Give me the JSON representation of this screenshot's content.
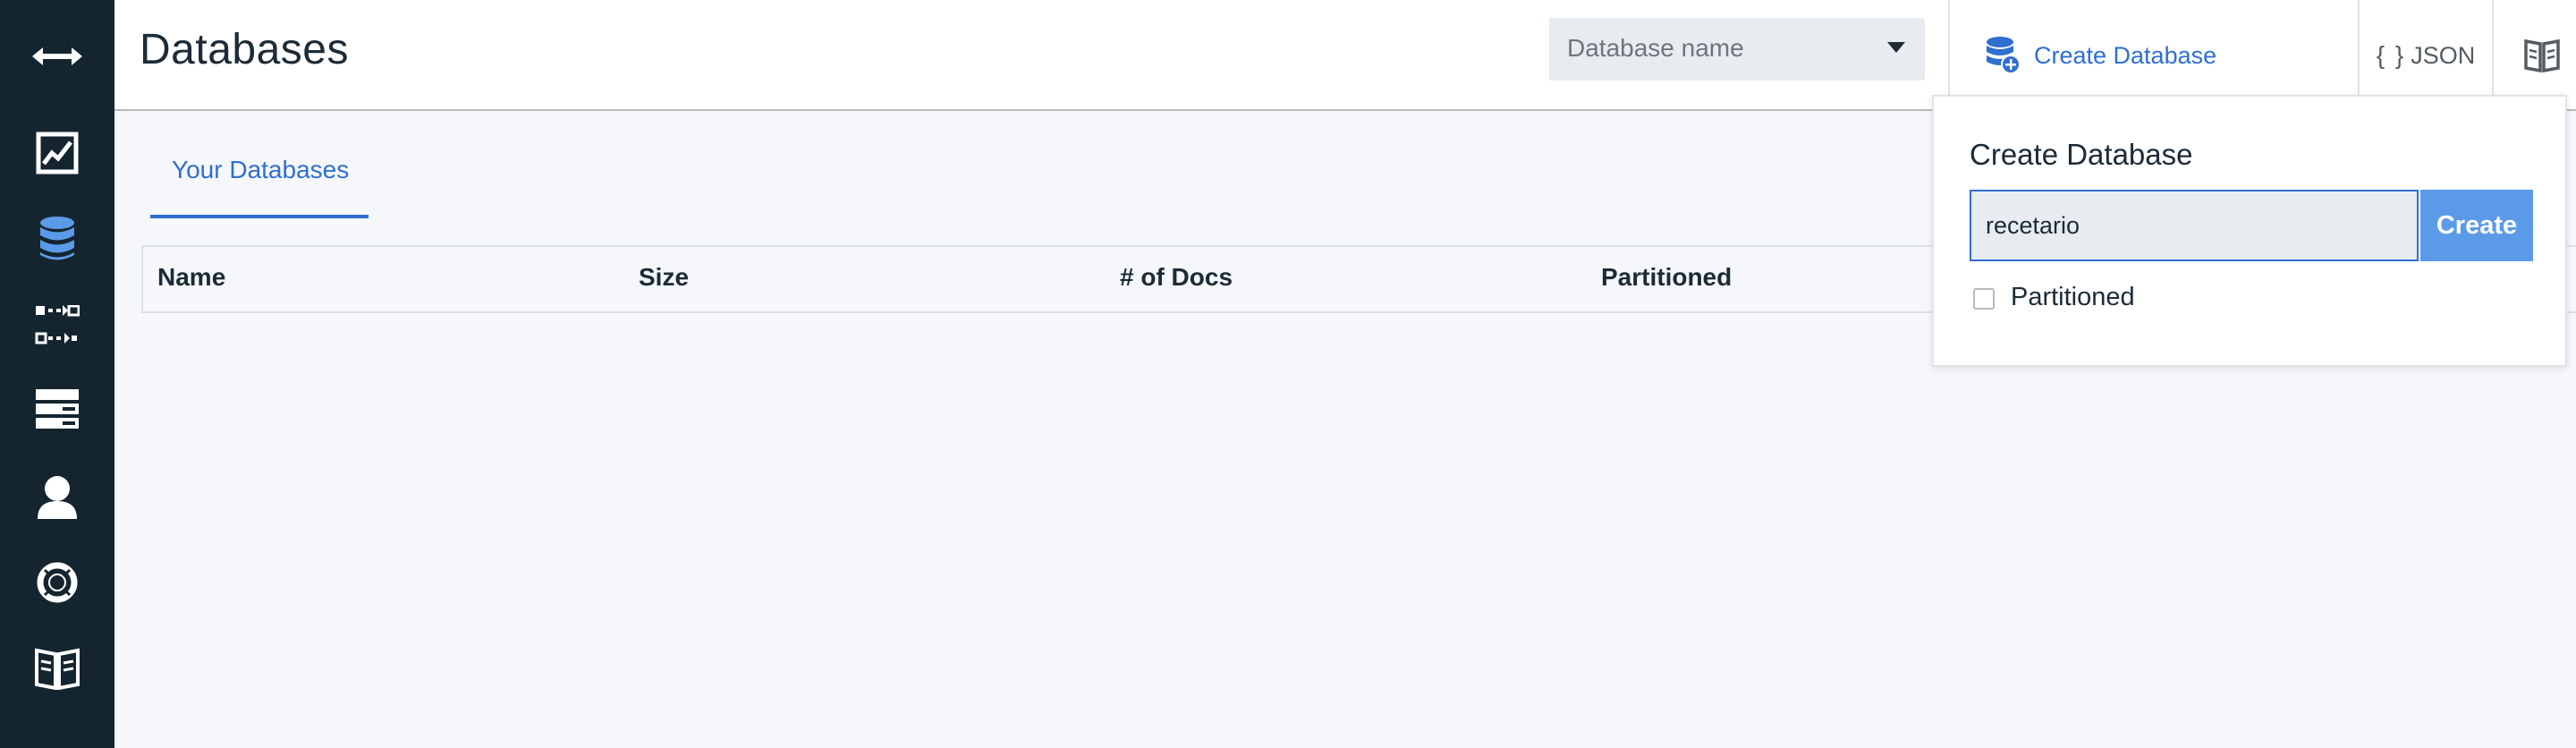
{
  "sidebar": {
    "items": [
      {
        "icon": "collapse-arrows-icon",
        "active": false
      },
      {
        "icon": "activity-chart-icon",
        "active": false
      },
      {
        "icon": "database-icon",
        "active": true
      },
      {
        "icon": "replication-icon",
        "active": false
      },
      {
        "icon": "server-rack-icon",
        "active": false
      },
      {
        "icon": "user-icon",
        "active": false
      },
      {
        "icon": "lifebuoy-icon",
        "active": false
      },
      {
        "icon": "book-icon",
        "active": false
      }
    ]
  },
  "header": {
    "title": "Databases",
    "search_placeholder": "Database name",
    "create_label": "Create Database",
    "json_braces": "{ }",
    "json_label": "JSON",
    "docs_icon": "book-icon",
    "notifications_icon": "bell-icon"
  },
  "tabs": [
    {
      "label": "Your Databases",
      "active": true
    }
  ],
  "table": {
    "columns": [
      "Name",
      "Size",
      "# of Docs",
      "Partitioned"
    ],
    "rows": []
  },
  "popover": {
    "title": "Create Database",
    "input_value": "recetario",
    "submit_label": "Create",
    "partitioned_label": "Partitioned",
    "partitioned_checked": false
  },
  "colors": {
    "sidebar_bg": "#142530",
    "accent": "#2f6fd0",
    "active_icon": "#5b9ae8",
    "button_bg": "#5b9ae8"
  }
}
